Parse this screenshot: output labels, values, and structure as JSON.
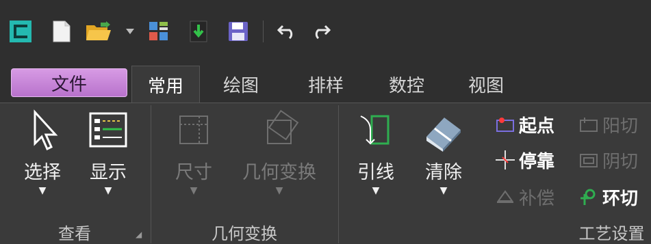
{
  "tabs": {
    "file": "文件",
    "common": "常用",
    "draw": "绘图",
    "nest": "排样",
    "cnc": "数控",
    "view": "视图"
  },
  "groups": {
    "view_group": {
      "label": "查看",
      "select": "选择",
      "display": "显示"
    },
    "geometry_group": {
      "label": "几何变换",
      "size": "尺寸",
      "transform": "几何变换"
    },
    "process_group": {
      "label": "工艺设置",
      "lead": "引线",
      "clear": "清除",
      "start_point": "起点",
      "stop": "停靠",
      "compensate": "补偿",
      "yang_cut": "阳切",
      "yin_cut": "阴切",
      "ring_cut": "环切"
    }
  },
  "colors": {
    "accent": "#c98ad9",
    "green": "#2fae50",
    "bg": "#3a3a3a"
  }
}
